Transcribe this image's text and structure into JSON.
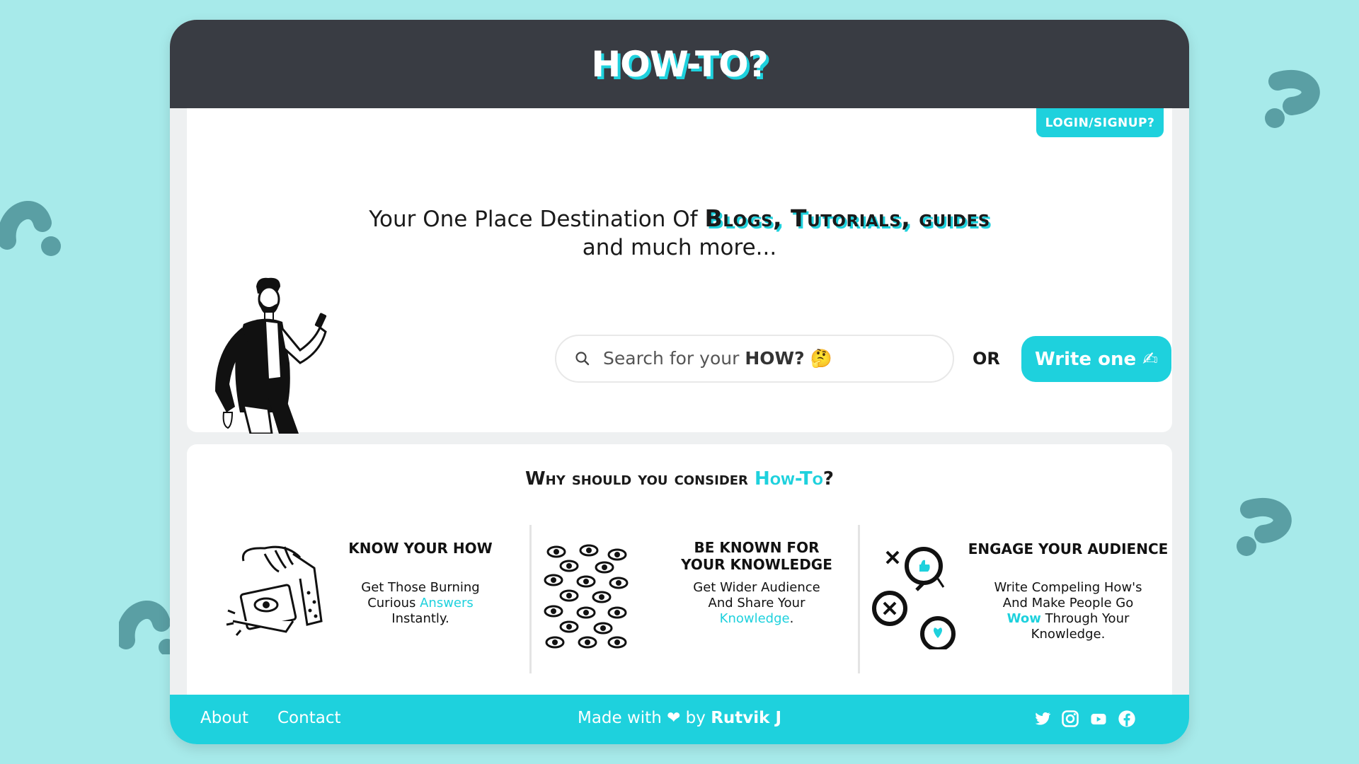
{
  "brand": {
    "title": "HOW-TO?"
  },
  "header": {
    "login_label": "LOGIN/SIGNUP?"
  },
  "hero": {
    "tagline_pre": "Your One Place Destination Of",
    "tagline_highlight": "Blogs, Tutorials, guides",
    "tagline_post": "and much more...",
    "search_placeholder_pre": "Search for your",
    "search_placeholder_bold": "HOW?",
    "search_emoji": "🤔",
    "or_label": "OR",
    "write_label": "Write one",
    "write_emoji": "✍"
  },
  "why": {
    "title_pre": "Why should you consider",
    "title_accent": "How-To",
    "title_post": "?",
    "features": [
      {
        "title": "KNOW YOUR HOW",
        "desc_pre": "Get Those Burning Curious",
        "desc_accent": "Answers",
        "desc_post": "Instantly."
      },
      {
        "title_line1": "BE KNOWN FOR",
        "title_line2": "YOUR KNOWLEDGE",
        "desc_pre": "Get Wider Audience And Share Your",
        "desc_accent": "Knowledge",
        "desc_post": "."
      },
      {
        "title": "ENGAGE YOUR AUDIENCE",
        "desc_pre": "Write Compeling How's And Make People Go",
        "desc_accent": "Wow",
        "desc_post": "Through Your Knowledge."
      }
    ]
  },
  "footer": {
    "about": "About",
    "contact": "Contact",
    "made_pre": "Made with",
    "made_heart": "❤",
    "made_by": "by",
    "author": "Rutvik J",
    "social_icons": [
      "twitter-icon",
      "instagram-icon",
      "youtube-icon",
      "facebook-icon"
    ]
  },
  "colors": {
    "accent": "#1ed1dd",
    "header_bg": "#393c43",
    "page_bg": "#a7eaea"
  }
}
